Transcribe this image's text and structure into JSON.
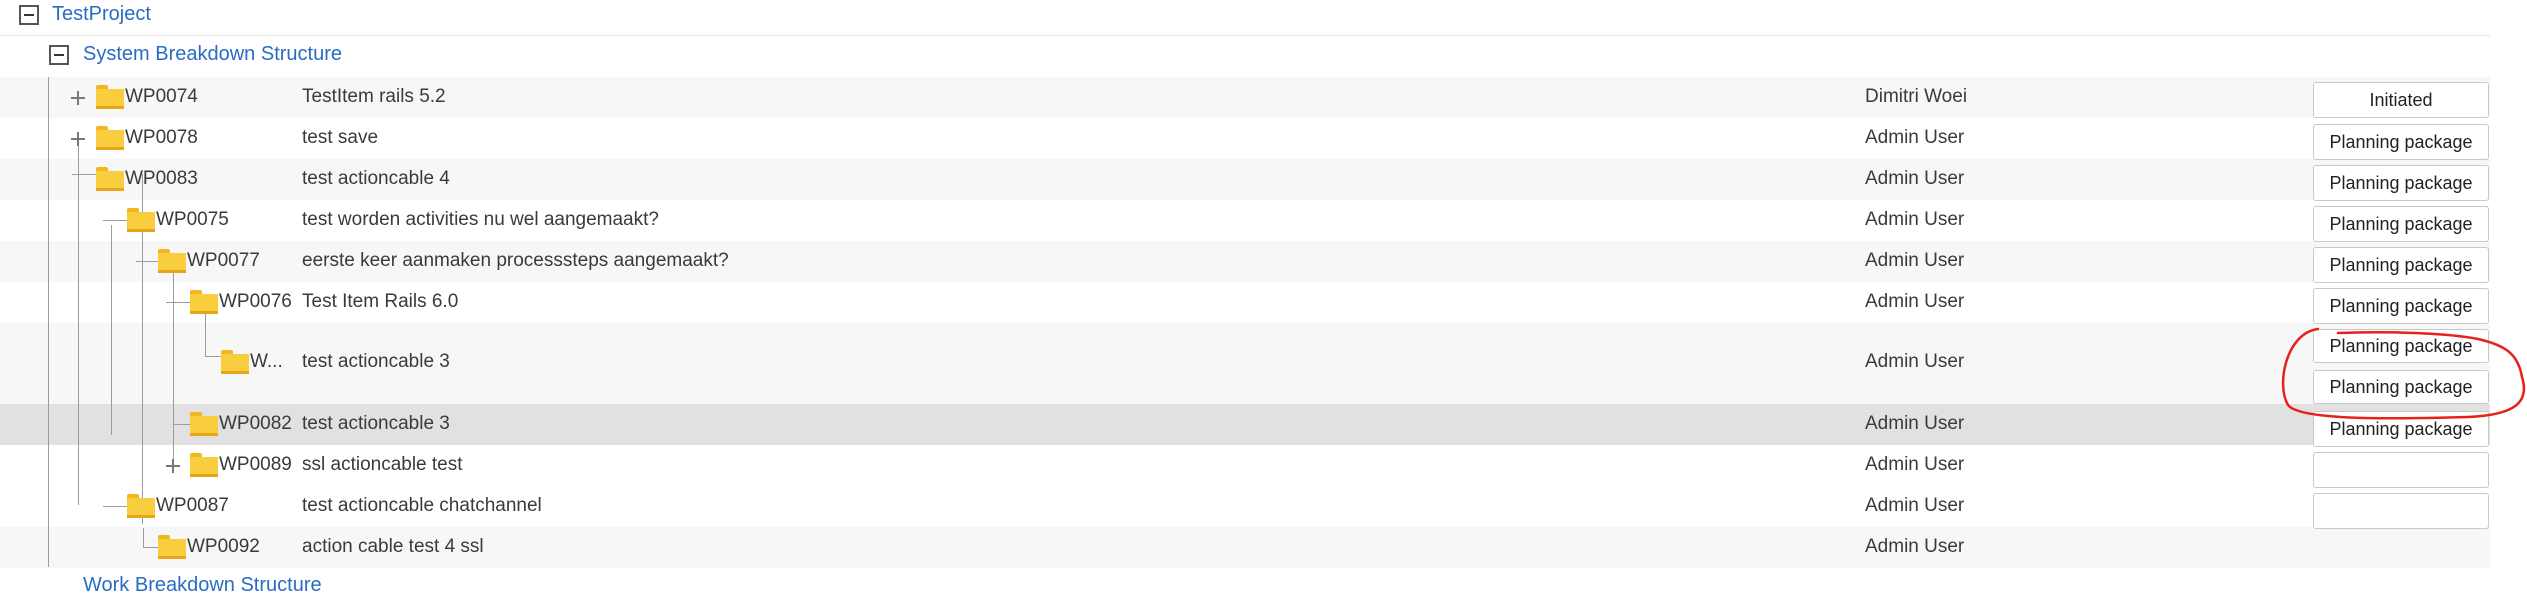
{
  "project": {
    "title": "TestProject"
  },
  "sbs": {
    "title": "System Breakdown Structure"
  },
  "wbs": {
    "title": "Work Breakdown Structure"
  },
  "rows": [
    {
      "code": "WP0074",
      "name": "TestItem rails 5.2",
      "owner": "Dimitri Woei",
      "status": "Initiated"
    },
    {
      "code": "WP0078",
      "name": "test save",
      "owner": "Admin User",
      "status": "Planning package"
    },
    {
      "code": "WP0083",
      "name": "test actioncable 4",
      "owner": "Admin User",
      "status": "Planning package"
    },
    {
      "code": "WP0075",
      "name": "test worden activities nu wel aangemaakt?",
      "owner": "Admin User",
      "status": "Planning package"
    },
    {
      "code": "WP0077",
      "name": "eerste keer aanmaken processsteps aangemaakt?",
      "owner": "Admin User",
      "status": "Planning package"
    },
    {
      "code": "WP0076",
      "name": "Test Item Rails 6.0",
      "owner": "Admin User",
      "status": "Planning package"
    },
    {
      "code": "W...",
      "name": "test actioncable 3",
      "owner": "Admin User",
      "status": "Planning package",
      "status2": "Planning package"
    },
    {
      "code": "WP0082",
      "name": "test actioncable 3",
      "owner": "Admin User",
      "status": "Planning package"
    },
    {
      "code": "WP0089",
      "name": "ssl actioncable test",
      "owner": "Admin User",
      "status": ""
    },
    {
      "code": "WP0087",
      "name": "test actioncable chatchannel",
      "owner": "Admin User",
      "status": ""
    },
    {
      "code": "WP0092",
      "name": "action cable test 4 ssl",
      "owner": "Admin User"
    }
  ],
  "colors": {
    "link": "#2a6cc4",
    "annotation": "#e8201c",
    "folder": "#f8cd3e",
    "selected_row": "#e1e1e1"
  }
}
